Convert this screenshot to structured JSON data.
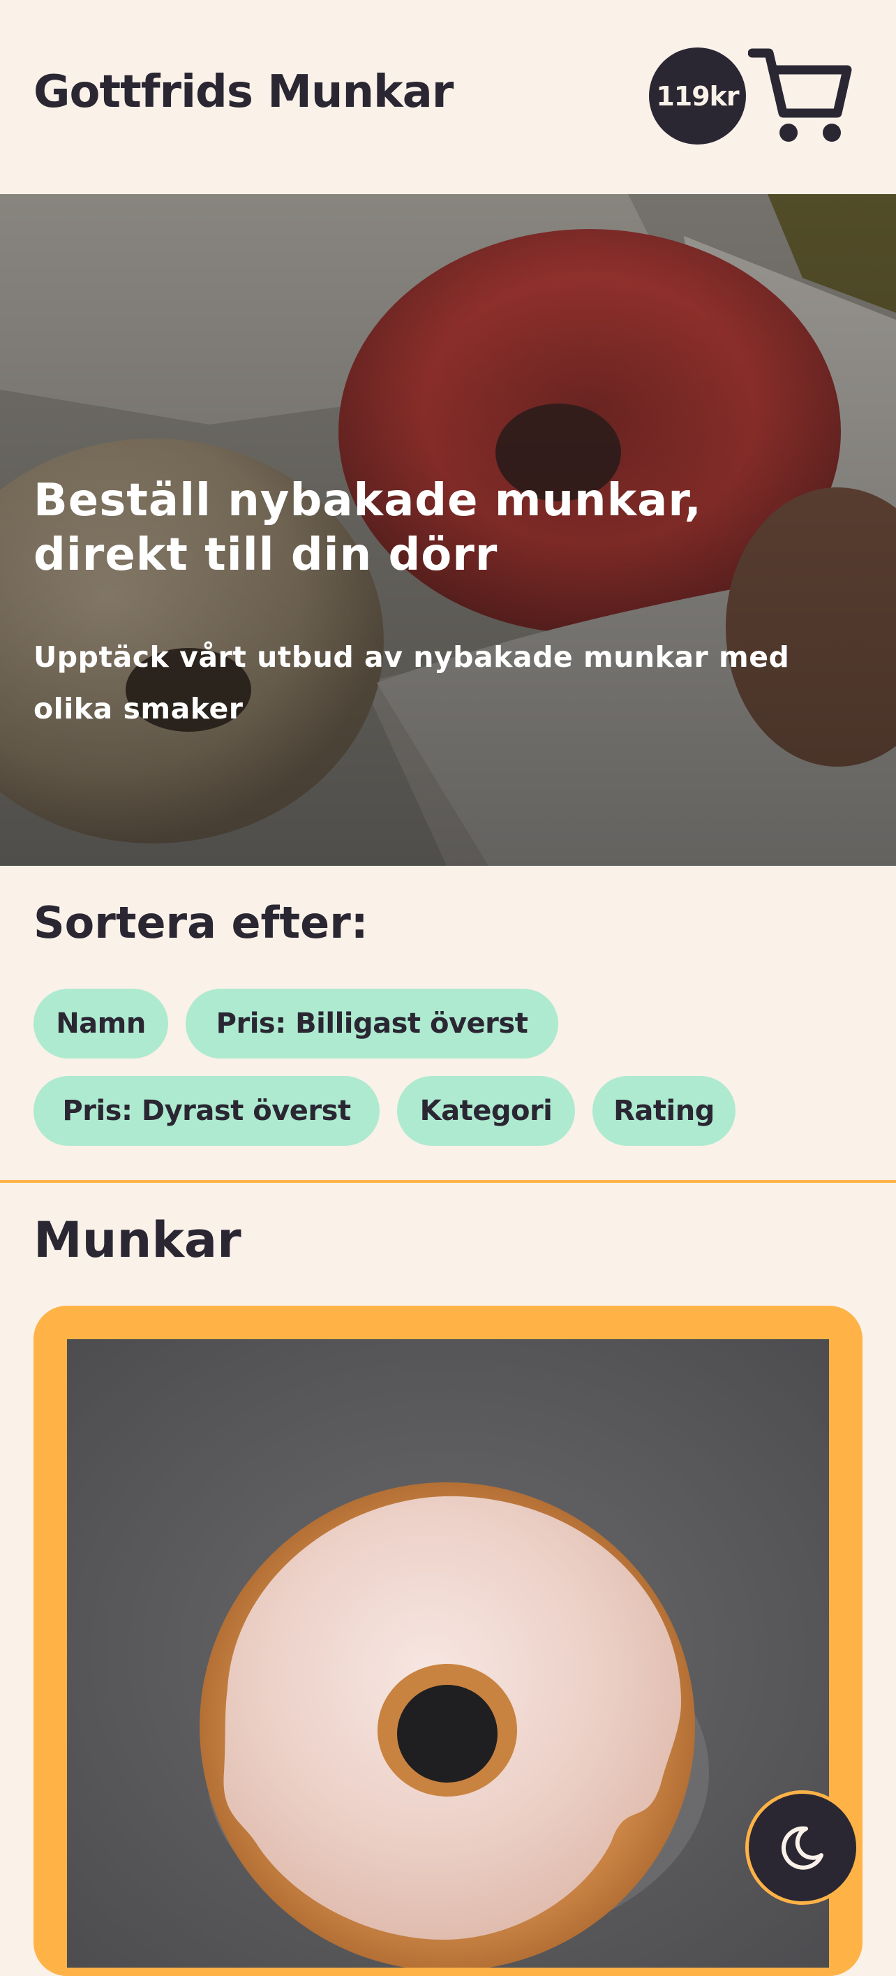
{
  "header": {
    "brand": "Gottfrids Munkar",
    "cart_total": "119kr",
    "cart_icon": "shopping-cart-icon"
  },
  "hero": {
    "title": "Beställ nybakade munkar, direkt till din dörr",
    "subtitle": "Upptäck vårt utbud av nybakade munkar med olika smaker"
  },
  "sort": {
    "heading": "Sortera efter:",
    "options": [
      "Namn",
      "Pris: Billigast överst",
      "Pris: Dyrast överst",
      "Kategori",
      "Rating"
    ]
  },
  "products": {
    "heading": "Munkar"
  },
  "theme_toggle": {
    "icon": "moon-icon"
  },
  "colors": {
    "background": "#faf1e9",
    "text": "#2a2733",
    "chip": "#aeead0",
    "accent": "#ffb347"
  }
}
